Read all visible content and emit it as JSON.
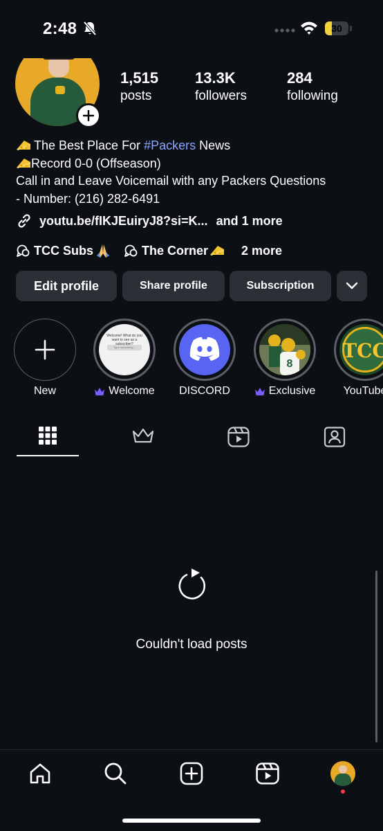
{
  "status_bar": {
    "time": "2:48",
    "battery": "30",
    "battery_level": 0.3
  },
  "profile": {
    "stats": [
      {
        "value": "1,515",
        "label": "posts"
      },
      {
        "value": "13.3K",
        "label": "followers"
      },
      {
        "value": "284",
        "label": "following"
      }
    ],
    "bio": {
      "line1_prefix": "The Best Place For ",
      "line1_hashtag": "#Packers",
      "line1_suffix": " News",
      "line2": "Record 0-0 (Offseason)",
      "line3": "Call in and Leave Voicemail with any Packers Questions",
      "line4": "- Number: (216) 282-6491"
    },
    "link": {
      "url": "youtu.be/fIKJEuiryJ8?si=K...",
      "more": "and 1 more"
    },
    "channels": {
      "first": "TCC Subs",
      "second": "The Corner",
      "more": "2 more"
    }
  },
  "buttons": {
    "edit": "Edit profile",
    "share": "Share profile",
    "subscription": "Subscription"
  },
  "highlights": [
    {
      "label": "New",
      "icon": "plus-icon"
    },
    {
      "label": "Welcome",
      "crown": true
    },
    {
      "label": "DISCORD"
    },
    {
      "label": "Exclusive",
      "crown": true
    },
    {
      "label": "YouTube"
    }
  ],
  "welcome_thumb": {
    "text": "Welcome! What do you want to see as a subscriber?",
    "field": "Type something..."
  },
  "youtube_thumb": {
    "text": "TCC"
  },
  "tabs": [
    "grid-icon",
    "crown-icon",
    "reels-icon",
    "tagged-icon"
  ],
  "empty_state": {
    "message": "Couldn't load posts"
  },
  "bottom_nav": [
    "home-icon",
    "search-icon",
    "create-icon",
    "reels-icon",
    "profile-avatar"
  ],
  "colors": {
    "accent_link": "#8aa6ff",
    "crown": "#7a5cff",
    "discord": "#5865f2",
    "packers_green": "#255a3b",
    "packers_gold": "#e8a928"
  }
}
